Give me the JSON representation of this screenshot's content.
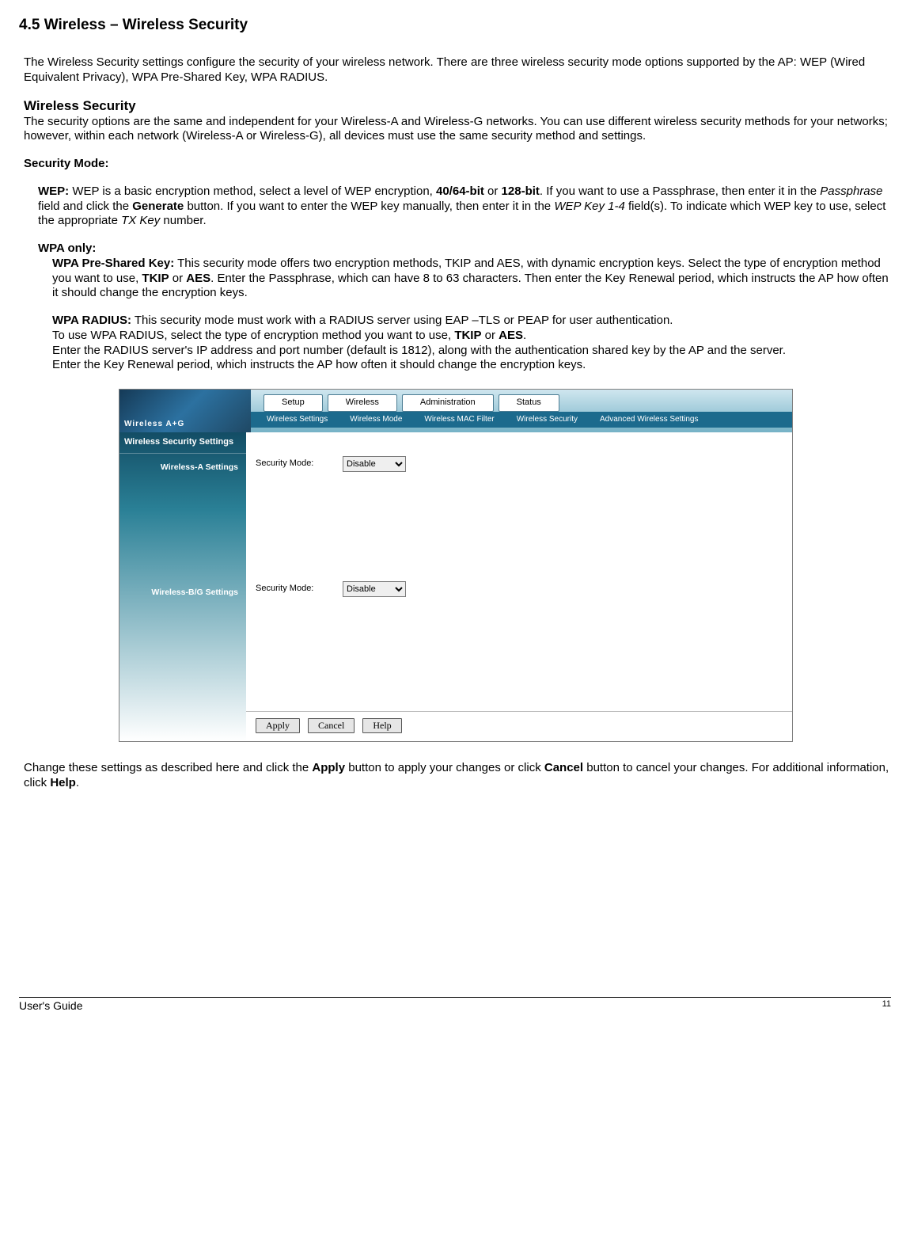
{
  "title": "4.5 Wireless – Wireless Security",
  "intro": "The Wireless Security settings configure the security of your wireless network. There are three wireless security mode options supported by the AP: WEP (Wired Equivalent Privacy), WPA Pre-Shared Key, WPA RADIUS.",
  "sec_heading": "Wireless Security",
  "sec_body": "The security options are the same and independent for your Wireless-A and Wireless-G networks. You can use different wireless security methods for your networks; however, within each network (Wireless-A or Wireless-G), all devices must use the same security method and settings.",
  "mode_heading": "Security Mode:",
  "wep_label": "WEP:",
  "wep_1": " WEP is a basic encryption method, select a level of WEP encryption, ",
  "wep_b1": "40/64-bit",
  "wep_or": " or ",
  "wep_b2": "128-bit",
  "wep_2": ". If you want to use a Passphrase, then enter it in the ",
  "wep_i1": "Passphrase",
  "wep_3": " field and click the ",
  "wep_b3": "Generate",
  "wep_4": " button. If you want to enter the WEP key manually, then enter it in the ",
  "wep_i2": "WEP Key 1-4",
  "wep_5": " field(s). To indicate which WEP key to use, select the appropriate ",
  "wep_i3": "TX Key",
  "wep_6": " number.",
  "wpa_only": "WPA only:",
  "psk_label": "WPA Pre-Shared Key:",
  "psk_1": " This security mode offers two encryption methods, TKIP and AES, with dynamic encryption keys. Select the type of encryption method you want to use, ",
  "psk_b1": "TKIP",
  "psk_or": " or ",
  "psk_b2": "AES",
  "psk_2": ". Enter the Passphrase, which can have 8 to 63 characters. Then enter the Key Renewal period, which instructs the AP how often it should change the encryption keys.",
  "rad_label": "WPA RADIUS:",
  "rad_1": " This security mode must work with a RADIUS server using EAP –TLS or PEAP for user authentication.",
  "rad_2a": "To use WPA RADIUS, select the type of encryption method you want to use, ",
  "rad_b1": "TKIP",
  "rad_or": " or ",
  "rad_b2": "AES",
  "rad_2b": ".",
  "rad_3": "Enter the RADIUS server's IP address and port number (default is 1812), along with the authentication shared key by the AP and the server.",
  "rad_4": "Enter the Key Renewal period, which instructs the AP how often it should change the encryption keys.",
  "closing_1": "Change these settings as described here and click the ",
  "closing_b1": "Apply",
  "closing_2": " button to apply your changes or click ",
  "closing_b2": "Cancel",
  "closing_3": " button to cancel your changes. For additional information, click ",
  "closing_b3": "Help",
  "closing_4": ".",
  "shot": {
    "brand": "Wireless A+G",
    "tabs": {
      "t1": "Setup",
      "t2": "Wireless",
      "t3": "Administration",
      "t4": "Status"
    },
    "subtabs": {
      "s1": "Wireless Settings",
      "s2": "Wireless Mode",
      "s3": "Wireless MAC Filter",
      "s4": "Wireless Security",
      "s5": "Advanced Wireless Settings"
    },
    "side_hdr": "Wireless Security Settings",
    "row_a": "Wireless-A Settings",
    "row_b": "Wireless-B/G Settings",
    "form_label": "Security Mode:",
    "select_val": "Disable",
    "btn_apply": "Apply",
    "btn_cancel": "Cancel",
    "btn_help": "Help"
  },
  "footer": {
    "left": "User's Guide",
    "right": "11"
  }
}
